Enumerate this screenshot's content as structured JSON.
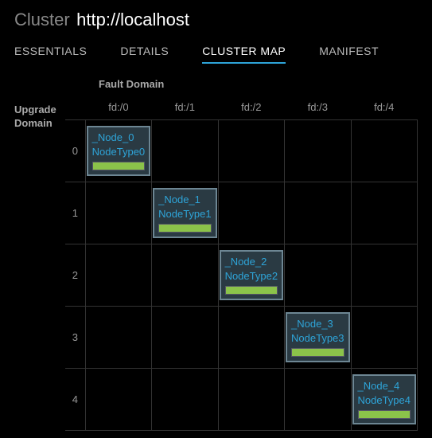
{
  "header": {
    "title_label": "Cluster",
    "title_url": "http://localhost"
  },
  "tabs": [
    {
      "label": "ESSENTIALS",
      "active": false
    },
    {
      "label": "DETAILS",
      "active": false
    },
    {
      "label": "CLUSTER MAP",
      "active": true
    },
    {
      "label": "MANIFEST",
      "active": false
    }
  ],
  "cluster_map": {
    "fault_domain_label": "Fault Domain",
    "upgrade_domain_label": "Upgrade\nDomain",
    "fault_domains": [
      "fd:/0",
      "fd:/1",
      "fd:/2",
      "fd:/3",
      "fd:/4"
    ],
    "upgrade_domains": [
      "0",
      "1",
      "2",
      "3",
      "4"
    ],
    "nodes": [
      {
        "ud": 0,
        "fd": 0,
        "name": "_Node_0",
        "type": "NodeType0",
        "status": "healthy"
      },
      {
        "ud": 1,
        "fd": 1,
        "name": "_Node_1",
        "type": "NodeType1",
        "status": "healthy"
      },
      {
        "ud": 2,
        "fd": 2,
        "name": "_Node_2",
        "type": "NodeType2",
        "status": "healthy"
      },
      {
        "ud": 3,
        "fd": 3,
        "name": "_Node_3",
        "type": "NodeType3",
        "status": "healthy"
      },
      {
        "ud": 4,
        "fd": 4,
        "name": "_Node_4",
        "type": "NodeType4",
        "status": "healthy"
      }
    ],
    "colors": {
      "accent": "#2ea4d8",
      "node_border": "#6d8693",
      "node_bg": "#2a3a43",
      "health_bar": "#8bc34a"
    }
  }
}
